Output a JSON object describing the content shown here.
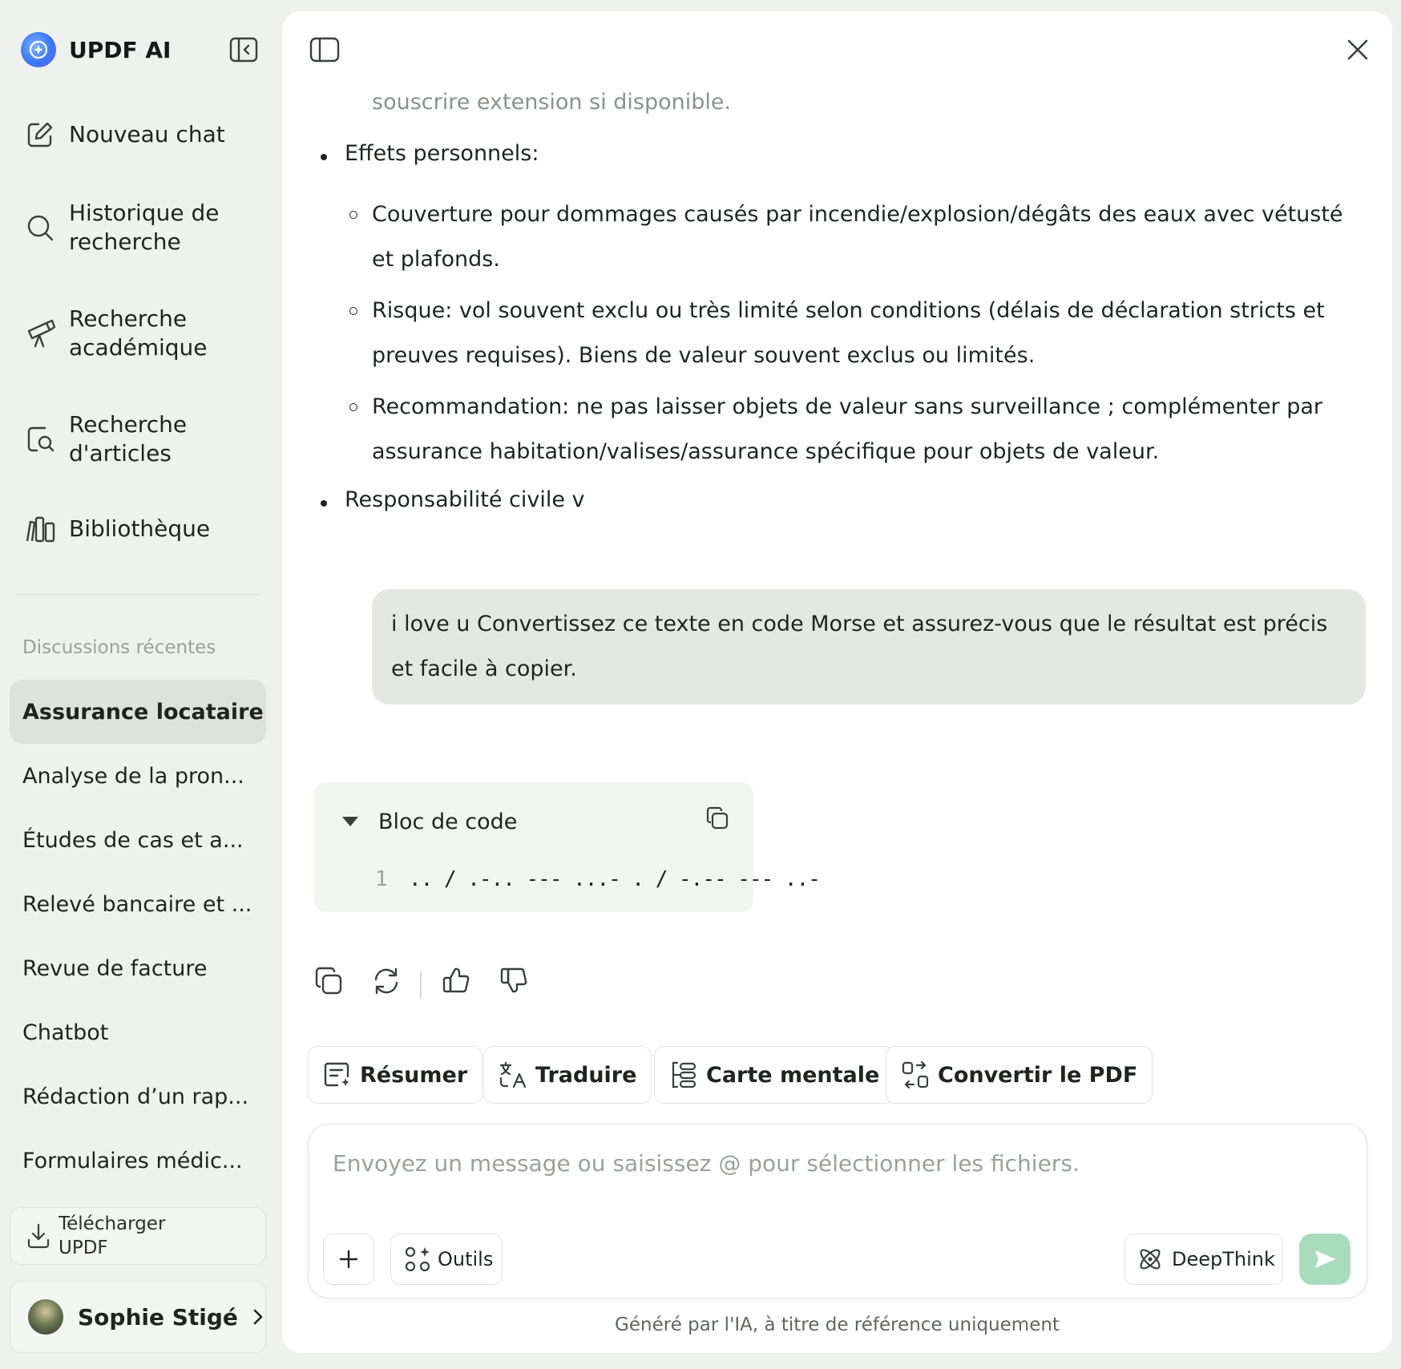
{
  "sidebar": {
    "brand": "UPDF AI",
    "nav": [
      {
        "label": "Nouveau chat",
        "icon": "edit-icon"
      },
      {
        "label": "Historique de recherche",
        "icon": "search-icon"
      },
      {
        "label": "Recherche académique",
        "icon": "telescope-icon"
      },
      {
        "label": "Recherche d'articles",
        "icon": "article-search-icon"
      },
      {
        "label": "Bibliothèque",
        "icon": "library-icon"
      }
    ],
    "recent_title": "Discussions récentes",
    "recent": [
      "Assurance locataire",
      "Analyse de la pron...",
      "Études de cas et a...",
      "Relevé bancaire et ...",
      "Revue de facture",
      "Chatbot",
      "Rédaction d’un rap...",
      "Formulaires médic..."
    ],
    "download": "Télécharger UPDF",
    "user_name": "Sophie Stigé"
  },
  "chat": {
    "faded_line": "souscrire extension si disponible.",
    "bullet1": "Effets personnels:",
    "sub1": "Couverture pour dommages causés par incendie/explosion/dégâts des eaux avec vétusté et plafonds.",
    "sub2": "Risque: vol souvent exclu ou très limité selon conditions (délais de déclaration stricts et preuves requises). Biens de valeur souvent exclus ou limités.",
    "sub3": "Recommandation: ne pas laisser objets de valeur sans surveillance ; complémenter par assurance habitation/valises/assurance spécifique pour objets de valeur.",
    "bullet2": "Responsabilité civile v",
    "user_message": "i love u Convertissez ce texte en code Morse et assurez-vous que le résultat est précis et facile à copier.",
    "code_block": {
      "title": "Bloc de code",
      "line_number": "1",
      "code": ".. / .-.. --- ...- . / -.-- --- ..-"
    }
  },
  "quick_actions": [
    "Résumer",
    "Traduire",
    "Carte mentale",
    "Convertir le PDF"
  ],
  "composer": {
    "placeholder": "Envoyez un message ou saisissez @ pour sélectionner les fichiers.",
    "tools_label": "Outils",
    "deepthink_label": "DeepThink"
  },
  "disclaimer": "Généré par l'IA, à titre de référence uniquement",
  "colors": {
    "sidebar_bg": "#eff1ef",
    "active_item_bg": "#dde2dd",
    "send_button": "#a9dcbc"
  }
}
